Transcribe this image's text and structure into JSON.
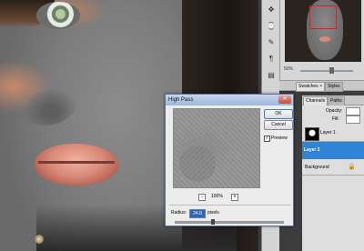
{
  "navigator": {
    "zoom": "50%"
  },
  "panel_tabs": {
    "swatches": "Swatches ×",
    "styles": "Styles"
  },
  "layers_panel": {
    "tabs": [
      "Channels",
      "Paths"
    ],
    "opacity_label": "Opacity:",
    "fill_label": "Fill:",
    "layers": [
      {
        "name": "Layer 1",
        "selected": false
      },
      {
        "name": "Layer 2",
        "selected": true
      },
      {
        "name": "Background",
        "selected": false,
        "locked": true
      }
    ]
  },
  "dialog": {
    "title": "High Pass",
    "ok_label": "OK",
    "cancel_label": "Cancel",
    "preview_label": "Preview",
    "preview_checked": true,
    "zoom_value": "100%",
    "zoom_out": "-",
    "zoom_in": "+",
    "radius_label": "Radius:",
    "radius_value": "24.8",
    "radius_unit": "pixels",
    "radius_slider_fraction": 0.35
  },
  "icons": [
    "close-icon",
    "lock-icon",
    "eye-icon",
    "move-icon",
    "zoom-icon"
  ],
  "colors": {
    "selected_layer": "#2f84d6",
    "title_bar": "#9db6dc",
    "navigator_box": "#e02020"
  }
}
